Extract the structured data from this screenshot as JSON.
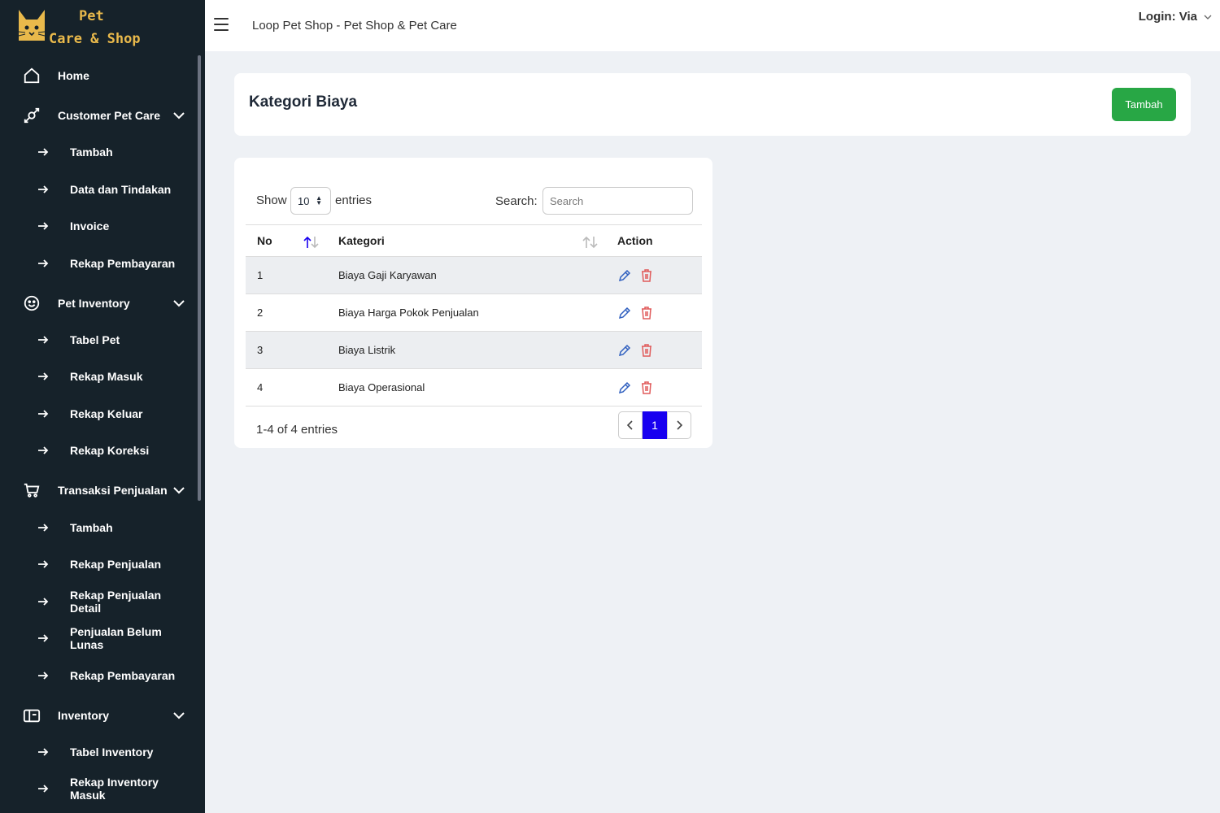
{
  "brand": {
    "line1": "Pet",
    "line2": "Care & Shop"
  },
  "header": {
    "title": "Loop Pet Shop - Pet Shop & Pet Care",
    "login": "Login: Via"
  },
  "sidebar": {
    "items": [
      {
        "label": "Home",
        "icon": "home-icon"
      },
      {
        "label": "Customer Pet Care",
        "icon": "pet-care-icon"
      },
      {
        "label": "Tambah"
      },
      {
        "label": "Data dan Tindakan"
      },
      {
        "label": "Invoice"
      },
      {
        "label": "Rekap Pembayaran"
      },
      {
        "label": "Pet Inventory",
        "icon": "smiley-icon"
      },
      {
        "label": "Tabel Pet"
      },
      {
        "label": "Rekap Masuk"
      },
      {
        "label": "Rekap Keluar"
      },
      {
        "label": "Rekap Koreksi"
      },
      {
        "label": "Transaksi Penjualan",
        "icon": "cart-icon"
      },
      {
        "label": "Tambah"
      },
      {
        "label": "Rekap Penjualan"
      },
      {
        "label": "Rekap Penjualan Detail"
      },
      {
        "label": "Penjualan Belum Lunas"
      },
      {
        "label": "Rekap Pembayaran"
      },
      {
        "label": "Inventory",
        "icon": "box-icon"
      },
      {
        "label": "Tabel Inventory"
      },
      {
        "label": "Rekap Inventory Masuk"
      }
    ]
  },
  "page": {
    "title": "Kategori Biaya",
    "add_label": "Tambah"
  },
  "table": {
    "show_label": "Show",
    "entries_value": "10",
    "entries_label": "entries",
    "search_label": "Search:",
    "search_placeholder": "Search",
    "headers": {
      "no": "No",
      "kategori": "Kategori",
      "action": "Action"
    },
    "rows": [
      {
        "no": "1",
        "kategori": "Biaya Gaji Karyawan"
      },
      {
        "no": "2",
        "kategori": "Biaya Harga Pokok Penjualan"
      },
      {
        "no": "3",
        "kategori": "Biaya Listrik"
      },
      {
        "no": "4",
        "kategori": "Biaya Operasional"
      }
    ],
    "info": "1-4 of 4 entries",
    "current_page": "1"
  },
  "colors": {
    "sidebar_bg": "#16222a",
    "add_button": "#28a745",
    "active_page": "#1800f0",
    "edit_icon": "#2f5fbf",
    "delete_icon": "#e05a5a"
  }
}
